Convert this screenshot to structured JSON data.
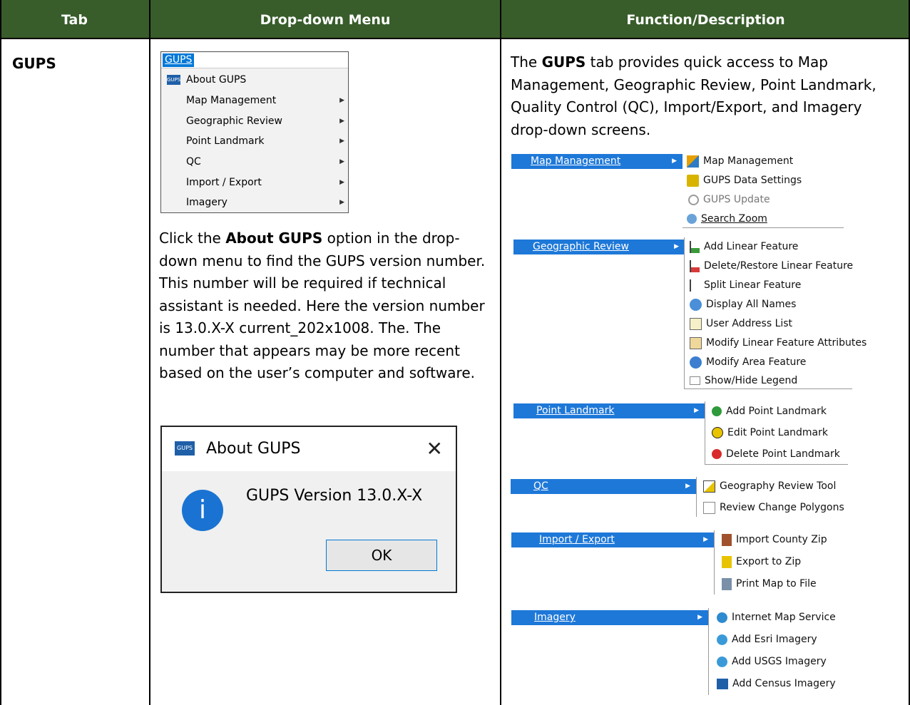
{
  "headers": [
    "Tab",
    "Drop-down Menu",
    "Function/Description"
  ],
  "tab_name": "GUPS",
  "gups_menu": {
    "title": "GUPS",
    "items": [
      {
        "label": "About GUPS",
        "has_submenu": false
      },
      {
        "label": "Map Management",
        "has_submenu": true
      },
      {
        "label": "Geographic Review",
        "has_submenu": true
      },
      {
        "label": "Point Landmark",
        "has_submenu": true
      },
      {
        "label": "QC",
        "has_submenu": true
      },
      {
        "label": "Import / Export",
        "has_submenu": true
      },
      {
        "label": "Imagery",
        "has_submenu": true
      }
    ]
  },
  "instructions": {
    "p1": "Click the ",
    "bold": "About GUPS",
    "p2": " option in the drop-down menu to find the GUPS version number. This number will be required if technical assistant is needed. Here the version number is 13.0.X-X current_202x1008. The. The number that appears may be more recent based on the user’s computer and software."
  },
  "about_dialog": {
    "logo": "GUPS",
    "title": "About GUPS",
    "message": "GUPS Version 13.0.X-X",
    "ok": "OK",
    "close_symbol": "✕",
    "info_symbol": "i"
  },
  "description": {
    "p1": "The ",
    "bold": "GUPS",
    "p2": " tab provides quick access to Map Management, Geographic Review, Point Landmark, Quality Control (QC), Import/Export, and Imagery drop-down screens."
  },
  "submenus": [
    {
      "parent": "Map Management",
      "items": [
        "Map Management",
        "GUPS Data Settings",
        "GUPS Update",
        "Search Zoom"
      ]
    },
    {
      "parent": "Geographic Review",
      "items": [
        "Add Linear Feature",
        "Delete/Restore Linear Feature",
        "Split Linear Feature",
        "Display All Names",
        "User Address List",
        "Modify Linear Feature Attributes",
        "Modify Area Feature",
        "Show/Hide Legend"
      ]
    },
    {
      "parent": "Point Landmark",
      "items": [
        "Add Point Landmark",
        "Edit Point Landmark",
        "Delete Point Landmark"
      ]
    },
    {
      "parent": "QC",
      "items": [
        "Geography Review Tool",
        "Review Change Polygons"
      ]
    },
    {
      "parent": "Import / Export",
      "items": [
        "Import County Zip",
        "Export to Zip",
        "Print Map to File"
      ]
    },
    {
      "parent": "Imagery",
      "items": [
        "Internet Map Service",
        "Add Esri Imagery",
        "Add USGS Imagery",
        "Add Census Imagery"
      ]
    }
  ],
  "colors": {
    "header_bg": "#385d2b",
    "menu_highlight": "#1e78d8"
  }
}
